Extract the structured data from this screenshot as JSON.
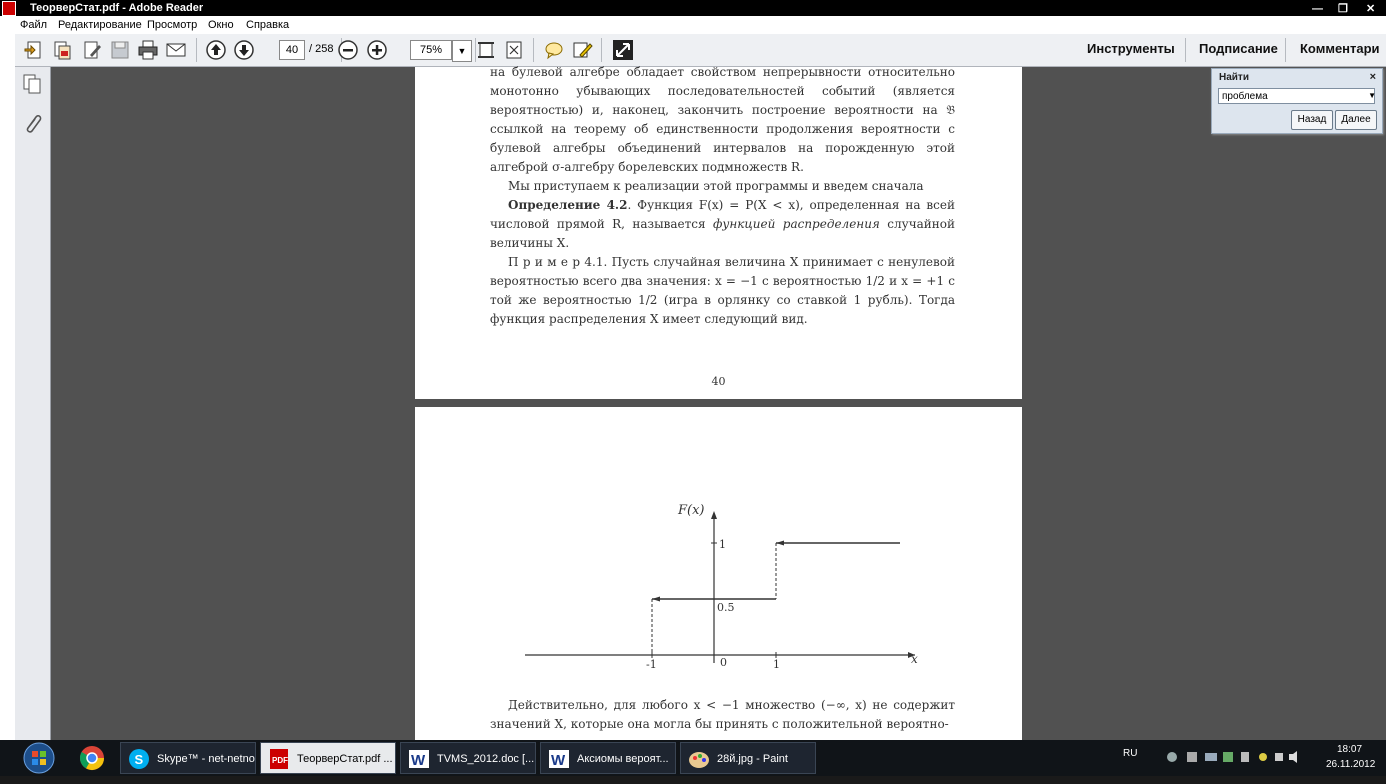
{
  "window": {
    "title": "ТеорверСтат.pdf - Adobe Reader"
  },
  "menu": [
    "Файл",
    "Редактирование",
    "Просмотр",
    "Окно",
    "Справка"
  ],
  "toolbar": {
    "page_current": "40",
    "page_total": "/ 258",
    "zoom": "75%",
    "tools_label": "Инструменты",
    "sign_label": "Подписание",
    "comment_label": "Комментари"
  },
  "find": {
    "title": "Найти",
    "query": "проблема",
    "back_label": "Назад",
    "next_label": "Далее"
  },
  "page1": {
    "para1": "на булевой алгебре обладает свойством непрерывности относительно монотонно убывающих последовательностей событий (является вероятностью) и, наконец, закончить построение вероятности на 𝔅 ссылкой на теорему об единственности продолжения вероятности с булевой алгебры объединений интервалов на порожденную этой алгеброй σ-алгебру борелевских подмножеств R.",
    "para2": "Мы приступаем к реализации этой программы и введем сначала",
    "def_head": "Определение 4.2",
    "def_body": ". Функция F(x) = P(X < x), определенная на всей числовой прямой R, называется ",
    "def_term": "функцией распределения",
    "def_tail": " случайной величины X.",
    "ex_head": "П р и м е р  4.1.",
    "ex_body": " Пусть случайная величина X принимает с ненулевой вероятностью всего два значения: x = −1 с вероятностью 1/2 и x = +1 с той же вероятностью 1/2 (игра в орлянку со ставкой 1 рубль). Тогда функция распределения X имеет следующий вид.",
    "page_number": "40"
  },
  "page2": {
    "graph": {
      "y_label": "F(x)",
      "x_label": "x",
      "y_tick_1": "1",
      "y_tick_half": "0.5",
      "x_tick_neg1": "-1",
      "x_tick_0": "0",
      "x_tick_1": "1"
    },
    "chart_data": {
      "type": "line",
      "title": "",
      "xlabel": "x",
      "ylabel": "F(x)",
      "series": [
        {
          "x": [
            -1,
            1
          ],
          "y": [
            0.5,
            0.5
          ]
        },
        {
          "x": [
            1,
            2
          ],
          "y": [
            1,
            1
          ]
        }
      ]
    },
    "para1": "Действительно, для любого x < −1 множество (−∞, x) не содержит значений X, которые она могла бы принять с положительной вероятно-"
  },
  "taskbar": {
    "items": [
      {
        "label": "Skype™ - net-netno"
      },
      {
        "label": "ТеорверСтат.pdf ..."
      },
      {
        "label": "TVMS_2012.doc [..."
      },
      {
        "label": "Аксиомы вероят..."
      },
      {
        "label": "28й.jpg - Paint"
      }
    ],
    "lang": "RU",
    "time": "18:07",
    "date": "26.11.2012"
  }
}
